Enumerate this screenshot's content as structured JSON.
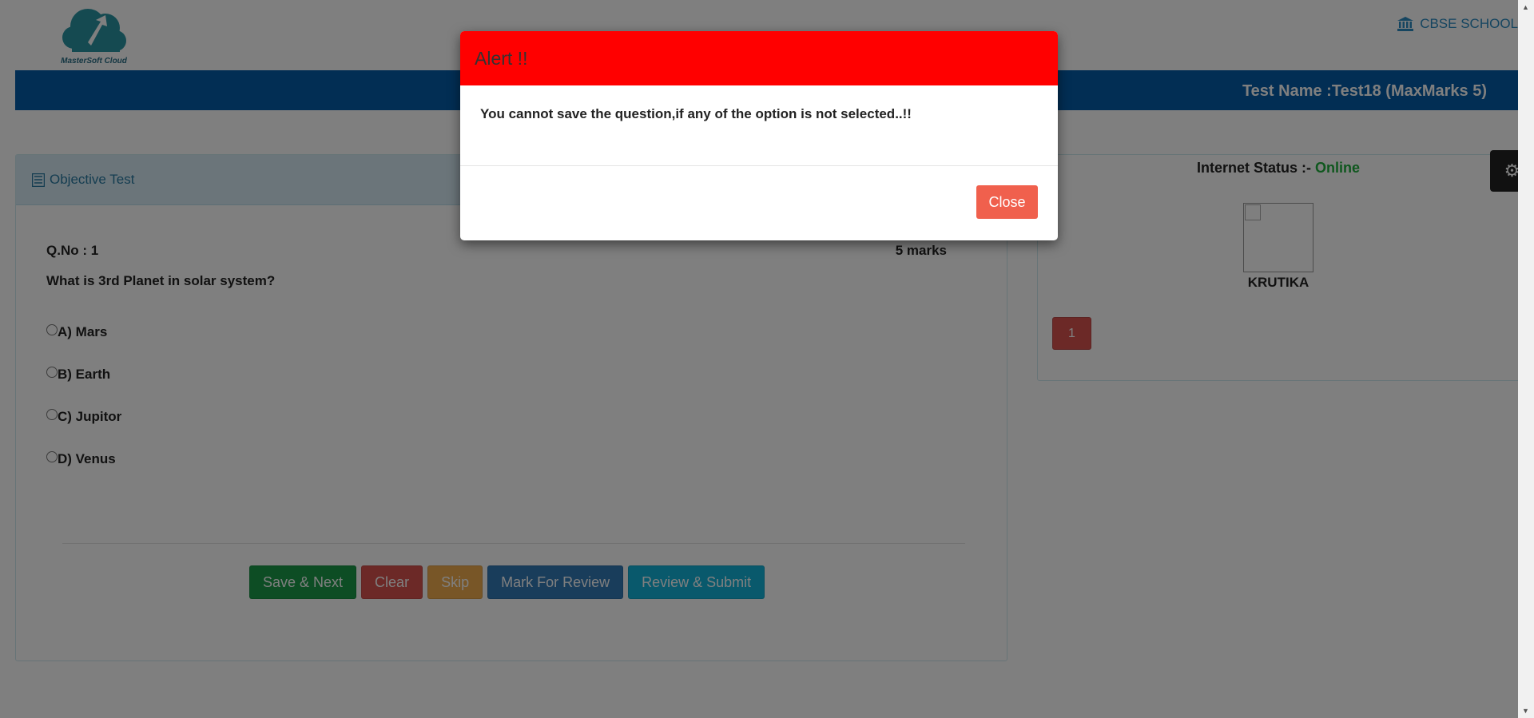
{
  "header": {
    "logo_text": "MasterSoft Cloud",
    "school_name": "CBSE SCHOOL",
    "test_name": "Test Name :Test18 (MaxMarks 5)"
  },
  "question_panel": {
    "title": "Objective Test",
    "qno": "Q.No : 1",
    "marks": "5 marks",
    "question": "What is 3rd Planet in solar system?",
    "options": [
      "A) Mars",
      "B) Earth",
      "C) Jupitor",
      "D) Venus"
    ],
    "buttons": {
      "save_next": "Save & Next",
      "clear": "Clear",
      "skip": "Skip",
      "mark_review": "Mark For Review",
      "review_submit": "Review & Submit"
    }
  },
  "status_panel": {
    "internet_label": "Internet Status :-",
    "internet_value": "Online",
    "student_name": "KRUTIKA",
    "question_numbers": [
      "1"
    ]
  },
  "modal": {
    "title": "Alert !!",
    "message": "You cannot save the question,if any of the option is not selected..!!",
    "close_label": "Close"
  },
  "icons": {
    "school": "bank-icon",
    "panel": "list-icon",
    "settings": "gear-icon"
  },
  "colors": {
    "topbar": "#045da8",
    "modal_header": "#ff0000",
    "online": "#1fae3c"
  }
}
